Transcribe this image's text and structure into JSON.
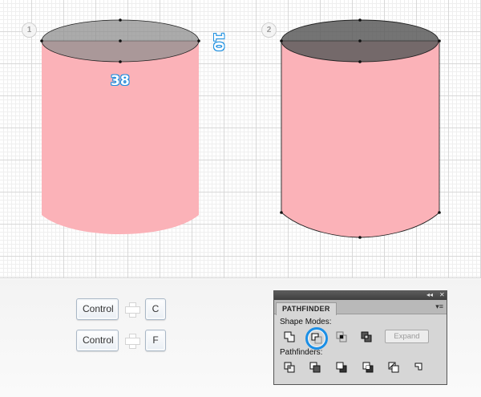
{
  "steps": {
    "step1": "1",
    "step2": "2"
  },
  "dimensions": {
    "height_label": "10",
    "width_label": "38"
  },
  "shortcuts": [
    {
      "modifier": "Control",
      "key": "C"
    },
    {
      "modifier": "Control",
      "key": "F"
    }
  ],
  "pathfinder": {
    "title": "PATHFINDER",
    "collapse_glyph": "◂◂",
    "close_glyph": "✕",
    "menu_glyph": "▾≡",
    "shape_modes_label": "Shape Modes:",
    "pathfinders_label": "Pathfinders:",
    "expand_label": "Expand",
    "shape_mode_icons": [
      "unite-icon",
      "minus-front-icon",
      "intersect-icon",
      "exclude-icon"
    ],
    "pathfinder_icons": [
      "divide-icon",
      "trim-icon",
      "merge-icon",
      "crop-icon",
      "outline-icon",
      "minus-back-icon"
    ],
    "active_shape_mode": "minus-front-icon"
  },
  "colors": {
    "cylinder_fill": "#fbb2b8",
    "ellipse_fill_light": "#9e9e9e",
    "ellipse_fill_dark": "#666666",
    "highlight": "#1b8fe6"
  }
}
